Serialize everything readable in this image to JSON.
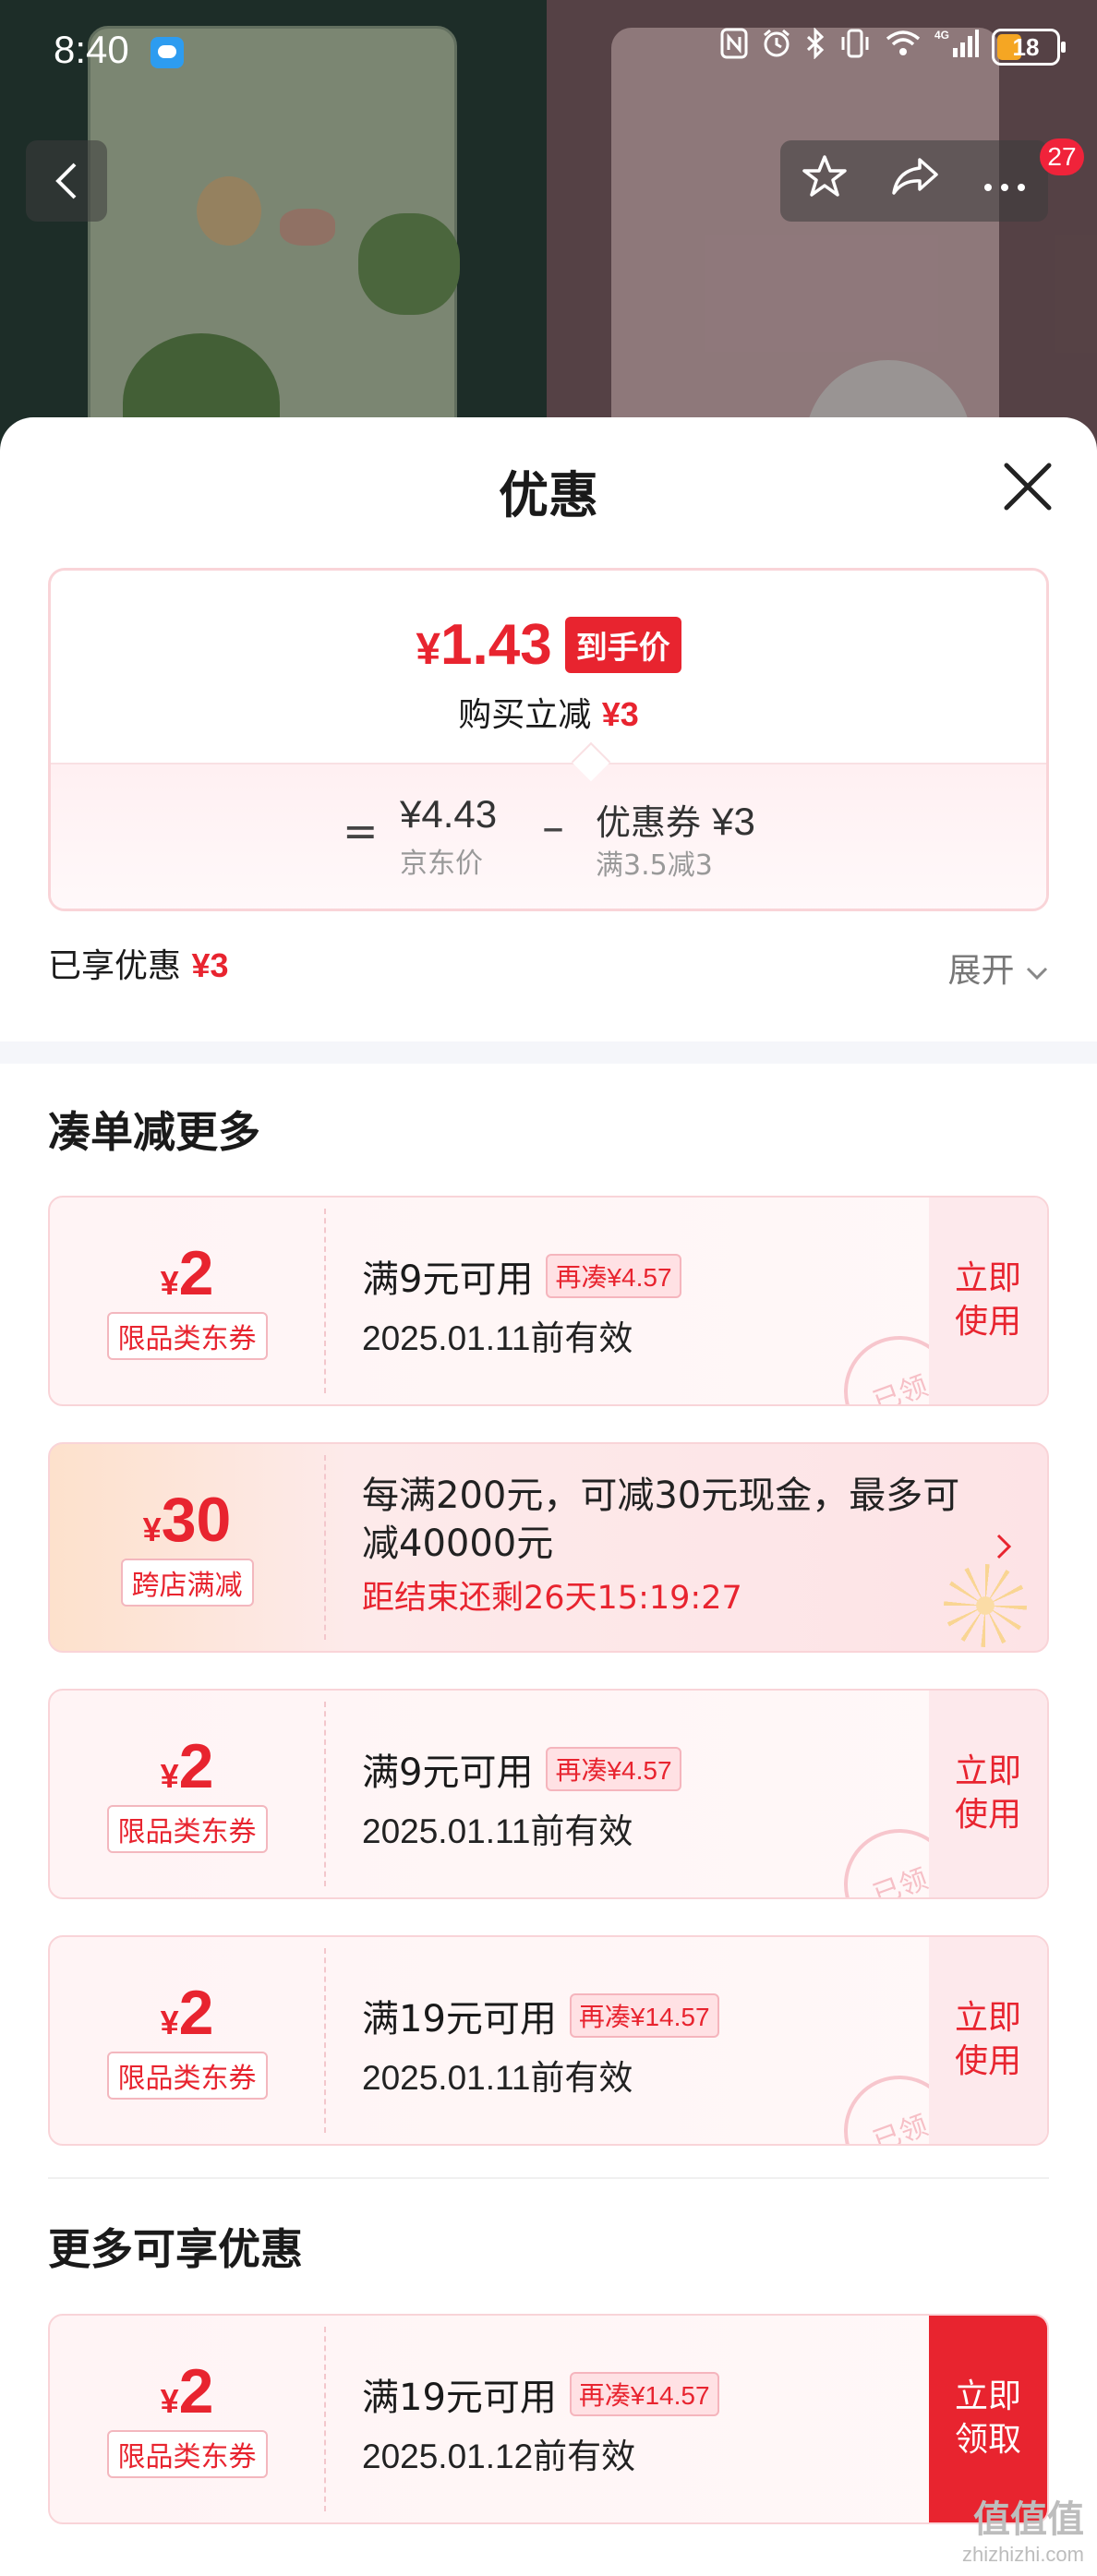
{
  "status_bar": {
    "time": "8:40",
    "battery": "18"
  },
  "nav": {
    "back_icon": "chevron-left",
    "badge": "27"
  },
  "sheet": {
    "title": "优惠",
    "summary": {
      "price_symbol": "¥",
      "price": "1.43",
      "price_tag": "到手价",
      "purchase_label": "购买立减",
      "purchase_amount": "¥3",
      "equals": "=",
      "jd_price": "¥4.43",
      "jd_price_label": "京东价",
      "minus": "–",
      "coupon_label": "优惠券",
      "coupon_amount": "¥3",
      "coupon_condition": "满3.5减3"
    },
    "enjoyed_label": "已享优惠",
    "enjoyed_amount": "¥3",
    "expand_label": "展开"
  },
  "section1": {
    "title": "凑单减更多"
  },
  "coupons": [
    {
      "symbol": "¥",
      "amount": "2",
      "category": "限品类东券",
      "condition": "满9元可用",
      "pill": "再凑¥4.57",
      "validity": "2025.01.11前有效",
      "action": "立即使用",
      "stamp": "已领"
    },
    {
      "symbol": "¥",
      "amount": "30",
      "category": "跨店满减",
      "desc": "每满200元，可减30元现金，最多可减40000元",
      "timer": "距结束还剩26天15:19:27"
    },
    {
      "symbol": "¥",
      "amount": "2",
      "category": "限品类东券",
      "condition": "满9元可用",
      "pill": "再凑¥4.57",
      "validity": "2025.01.11前有效",
      "action": "立即使用",
      "stamp": "已领"
    },
    {
      "symbol": "¥",
      "amount": "2",
      "category": "限品类东券",
      "condition": "满19元可用",
      "pill": "再凑¥14.57",
      "validity": "2025.01.11前有效",
      "action": "立即使用",
      "stamp": "已领"
    }
  ],
  "section2": {
    "title": "更多可享优惠"
  },
  "more_coupons": [
    {
      "symbol": "¥",
      "amount": "2",
      "category": "限品类东券",
      "condition": "满19元可用",
      "pill": "再凑¥14.57",
      "validity": "2025.01.12前有效",
      "action": "立即领取"
    }
  ],
  "watermark": {
    "logo": "值值值",
    "site": "zhizhizhi.com"
  },
  "colors": {
    "accent": "#e8242f",
    "coupon_border": "#f9d4d8"
  }
}
